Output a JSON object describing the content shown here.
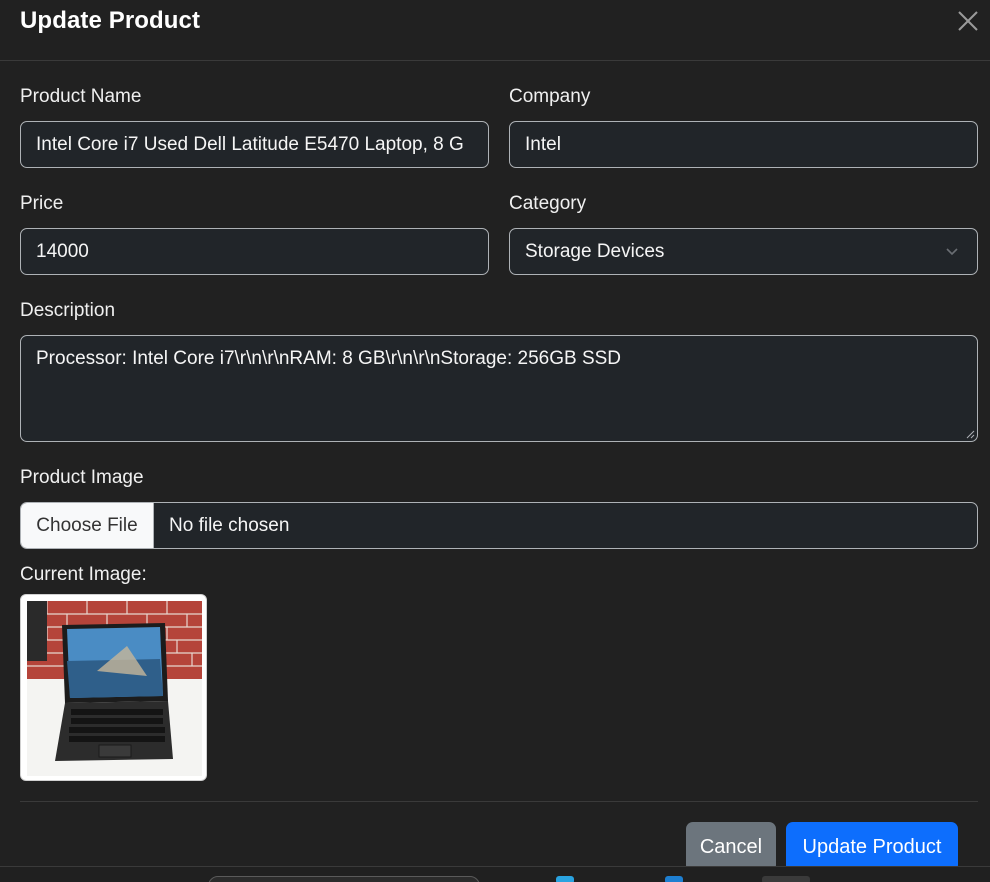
{
  "modal": {
    "title": "Update Product"
  },
  "form": {
    "product_name": {
      "label": "Product Name",
      "value": "Intel Core i7 Used Dell Latitude E5470 Laptop, 8 G"
    },
    "company": {
      "label": "Company",
      "value": "Intel"
    },
    "price": {
      "label": "Price",
      "value": "14000"
    },
    "category": {
      "label": "Category",
      "selected": "Storage Devices"
    },
    "description": {
      "label": "Description",
      "value": "Processor: Intel Core i7\\r\\n\\r\\nRAM: 8 GB\\r\\n\\r\\nStorage: 256GB SSD"
    },
    "product_image": {
      "label": "Product Image",
      "button_label": "Choose File",
      "status": "No file chosen"
    },
    "current_image": {
      "label": "Current Image:"
    }
  },
  "footer": {
    "cancel_label": "Cancel",
    "submit_label": "Update Product"
  },
  "colors": {
    "background": "#212121",
    "input_background": "#212529",
    "primary": "#0d6efd",
    "secondary": "#6c757d"
  },
  "icons": {
    "close": "close-icon",
    "select": "chevron-down-icon"
  }
}
